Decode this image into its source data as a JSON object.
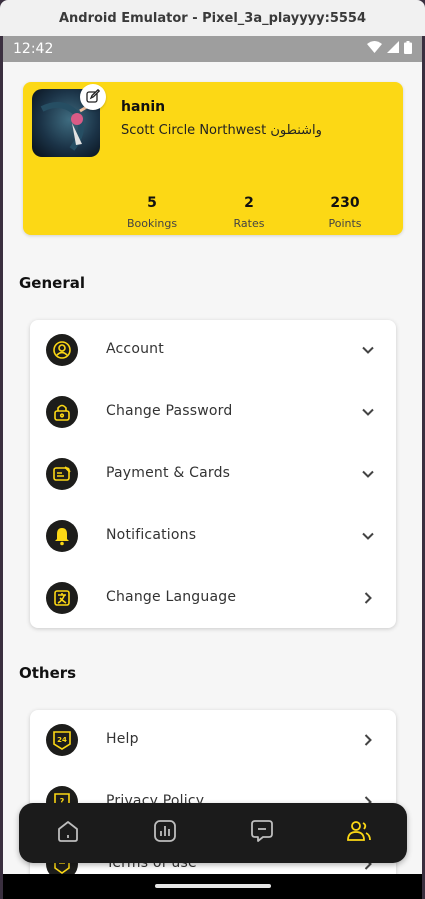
{
  "window": {
    "title": "Android Emulator - Pixel_3a_playyyy:5554"
  },
  "statusbar": {
    "time": "12:42"
  },
  "profile": {
    "name": "hanin",
    "address": "Scott Circle Northwest واشنطون",
    "stats": [
      {
        "value": "5",
        "label": "Bookings"
      },
      {
        "value": "2",
        "label": "Rates"
      },
      {
        "value": "230",
        "label": "Points"
      }
    ]
  },
  "general": {
    "title": "General",
    "items": [
      {
        "label": "Account",
        "icon": "account-icon",
        "chevron": "down"
      },
      {
        "label": "Change Password",
        "icon": "lock-icon",
        "chevron": "down"
      },
      {
        "label": "Payment & Cards",
        "icon": "card-icon",
        "chevron": "down"
      },
      {
        "label": "Notifications",
        "icon": "bell-icon",
        "chevron": "down"
      },
      {
        "label": "Change Language",
        "icon": "language-icon",
        "chevron": "right"
      }
    ]
  },
  "others": {
    "title": "Others",
    "items": [
      {
        "label": "Help",
        "icon": "help-24-icon",
        "chevron": "right"
      },
      {
        "label": "Privacy Policy",
        "icon": "privacy-icon",
        "chevron": "right"
      },
      {
        "label": "Terms of use",
        "icon": "terms-icon",
        "chevron": "right"
      }
    ]
  },
  "nav": {
    "items": [
      "home-icon",
      "stats-icon",
      "messages-icon",
      "profile-icon"
    ],
    "active": "profile-icon"
  },
  "colors": {
    "accent": "#FCD815",
    "dark": "#1D1D1B",
    "background": "#F6F6F6"
  }
}
